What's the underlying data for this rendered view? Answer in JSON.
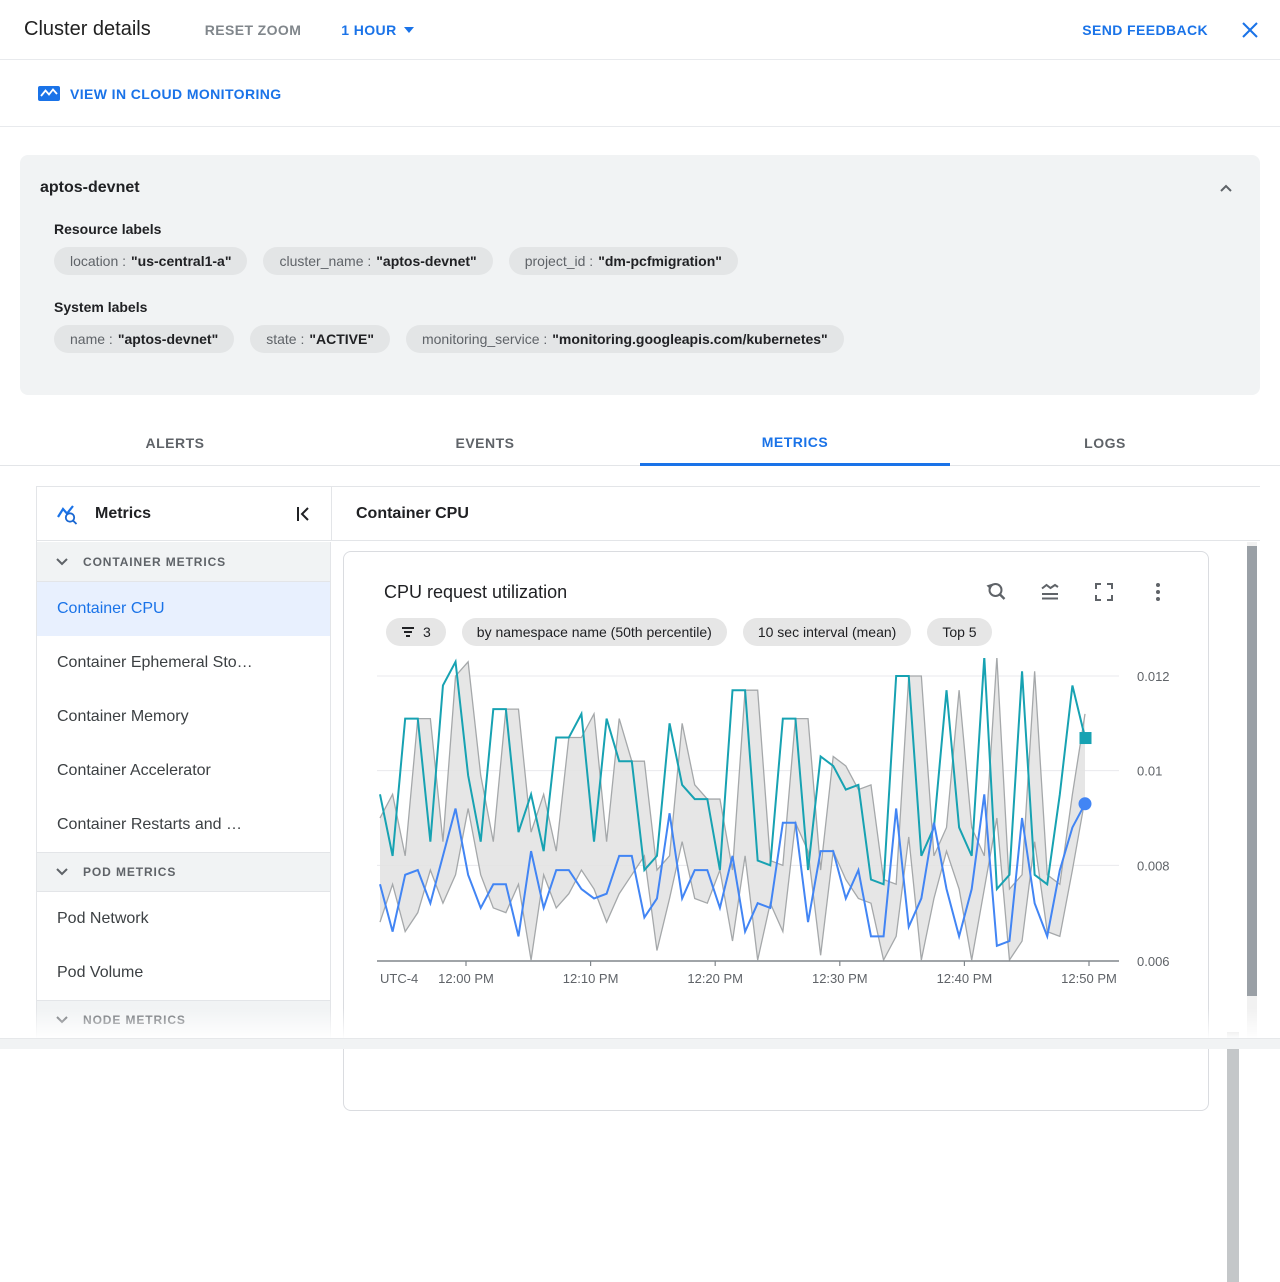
{
  "header": {
    "title": "Cluster details",
    "reset_zoom": "RESET ZOOM",
    "time_range": "1 HOUR",
    "send_feedback": "SEND FEEDBACK"
  },
  "monitoring_link": {
    "label": "VIEW IN CLOUD MONITORING"
  },
  "cluster_card": {
    "title": "aptos-devnet",
    "resource_labels_title": "Resource labels",
    "resource_labels": [
      {
        "key": "location :",
        "value": "\"us-central1-a\""
      },
      {
        "key": "cluster_name :",
        "value": "\"aptos-devnet\""
      },
      {
        "key": "project_id :",
        "value": "\"dm-pcfmigration\""
      }
    ],
    "system_labels_title": "System labels",
    "system_labels": [
      {
        "key": "name :",
        "value": "\"aptos-devnet\""
      },
      {
        "key": "state :",
        "value": "\"ACTIVE\""
      },
      {
        "key": "monitoring_service :",
        "value": "\"monitoring.googleapis.com/kubernetes\""
      }
    ]
  },
  "tabs": [
    {
      "label": "ALERTS"
    },
    {
      "label": "EVENTS"
    },
    {
      "label": "METRICS",
      "active": true
    },
    {
      "label": "LOGS"
    }
  ],
  "sidebar": {
    "title": "Metrics",
    "selected_item": "Container CPU",
    "sections": [
      {
        "label": "CONTAINER METRICS",
        "items": [
          "Container CPU",
          "Container Ephemeral Sto…",
          "Container Memory",
          "Container Accelerator",
          "Container Restarts and …"
        ]
      },
      {
        "label": "POD METRICS",
        "items": [
          "Pod Network",
          "Pod Volume"
        ]
      },
      {
        "label": "NODE METRICS",
        "items": []
      }
    ]
  },
  "main": {
    "header": "Container CPU"
  },
  "chart_card": {
    "title": "CPU request utilization",
    "chips": [
      {
        "icon": "filter-icon",
        "label": "3"
      },
      {
        "label": "by namespace name (50th percentile)"
      },
      {
        "label": "10 sec interval (mean)"
      },
      {
        "label": "Top 5"
      }
    ]
  },
  "chart_data": {
    "type": "line",
    "title": "CPU request utilization",
    "grid": true,
    "legend": "none",
    "ylim": [
      0.0059,
      0.0123
    ],
    "x_axis": {
      "timezone_label": "UTC-4",
      "tick_labels": [
        "12:00 PM",
        "12:10 PM",
        "12:20 PM",
        "12:30 PM",
        "12:40 PM",
        "12:50 PM"
      ]
    },
    "y_axis": {
      "tick_labels": [
        "0.012",
        "0.01",
        "0.008",
        "0.006"
      ],
      "tick_values": [
        0.012,
        0.01,
        0.008,
        0.006
      ]
    },
    "series": [
      {
        "name": "teal-series",
        "type": "line",
        "color": "#17a2b2",
        "marker": "square",
        "values": [
          0.0095,
          0.0082,
          0.0111,
          0.0111,
          0.0085,
          0.0118,
          0.0123,
          0.0099,
          0.0085,
          0.0113,
          0.0113,
          0.0087,
          0.0095,
          0.0083,
          0.0107,
          0.0107,
          0.0112,
          0.0085,
          0.0111,
          0.0102,
          0.0102,
          0.0079,
          0.0082,
          0.011,
          0.0097,
          0.0094,
          0.0094,
          0.0079,
          0.0117,
          0.0117,
          0.0081,
          0.008,
          0.0111,
          0.0111,
          0.0079,
          0.0103,
          0.0101,
          0.0096,
          0.0097,
          0.0077,
          0.0076,
          0.012,
          0.012,
          0.0082,
          0.0088,
          0.0117,
          0.0088,
          0.0082,
          0.0124,
          0.0075,
          0.0078,
          0.0121,
          0.0078,
          0.0076,
          0.0095,
          0.0118,
          0.0107
        ]
      },
      {
        "name": "blue-series",
        "type": "line",
        "color": "#4285f4",
        "marker": "circle",
        "values": [
          0.0076,
          0.0066,
          0.0078,
          0.0079,
          0.0072,
          0.0082,
          0.0092,
          0.0078,
          0.0071,
          0.0076,
          0.0076,
          0.0065,
          0.0083,
          0.0071,
          0.0079,
          0.0079,
          0.0075,
          0.0073,
          0.0074,
          0.0082,
          0.0082,
          0.0069,
          0.0073,
          0.0091,
          0.0073,
          0.0079,
          0.0079,
          0.0071,
          0.0082,
          0.0066,
          0.0072,
          0.0071,
          0.0089,
          0.0089,
          0.0068,
          0.0083,
          0.0083,
          0.0073,
          0.0079,
          0.0065,
          0.0065,
          0.0092,
          0.0067,
          0.0073,
          0.0089,
          0.0075,
          0.0065,
          0.0075,
          0.0095,
          0.0063,
          0.0064,
          0.009,
          0.0072,
          0.0065,
          0.0079,
          0.0088,
          0.0093
        ]
      },
      {
        "name": "range-band",
        "type": "band",
        "color": "#a5a8aa",
        "fill": "#e2e2e2",
        "upper": [
          0.009,
          0.0095,
          0.0082,
          0.0111,
          0.0111,
          0.0085,
          0.012,
          0.0123,
          0.0099,
          0.0085,
          0.0113,
          0.0113,
          0.0087,
          0.0095,
          0.0083,
          0.0107,
          0.0107,
          0.0112,
          0.0085,
          0.0111,
          0.0102,
          0.0102,
          0.0079,
          0.0082,
          0.011,
          0.0097,
          0.0094,
          0.0094,
          0.0079,
          0.0117,
          0.0117,
          0.0081,
          0.008,
          0.0111,
          0.0111,
          0.0079,
          0.0103,
          0.0101,
          0.0096,
          0.0097,
          0.0077,
          0.0076,
          0.012,
          0.012,
          0.0082,
          0.0088,
          0.0117,
          0.0088,
          0.0082,
          0.0124,
          0.0075,
          0.0078,
          0.0121,
          0.0078,
          0.0076,
          0.0095,
          0.0112
        ],
        "lower": [
          0.0068,
          0.0076,
          0.0066,
          0.007,
          0.0079,
          0.0072,
          0.0078,
          0.0092,
          0.0078,
          0.0071,
          0.007,
          0.0076,
          0.006,
          0.0078,
          0.0071,
          0.0074,
          0.0079,
          0.0075,
          0.0068,
          0.0074,
          0.0078,
          0.0082,
          0.0062,
          0.0073,
          0.0085,
          0.0073,
          0.0072,
          0.0079,
          0.0064,
          0.0082,
          0.006,
          0.0072,
          0.0066,
          0.0089,
          0.0083,
          0.0061,
          0.0083,
          0.0077,
          0.0073,
          0.0072,
          0.006,
          0.0065,
          0.0086,
          0.006,
          0.0073,
          0.0083,
          0.0075,
          0.006,
          0.0075,
          0.009,
          0.006,
          0.0064,
          0.0085,
          0.0066,
          0.0065,
          0.0079,
          0.0094
        ]
      }
    ]
  },
  "colors": {
    "accent": "#1a73e8",
    "selected_bg": "#e8f0fe",
    "card_bg": "#f1f3f4",
    "chip_bg": "#e3e5e6",
    "border": "#e3e5e8",
    "teal": "#17a2b2",
    "blue": "#4285f4",
    "band_fill": "#e2e2e2"
  }
}
